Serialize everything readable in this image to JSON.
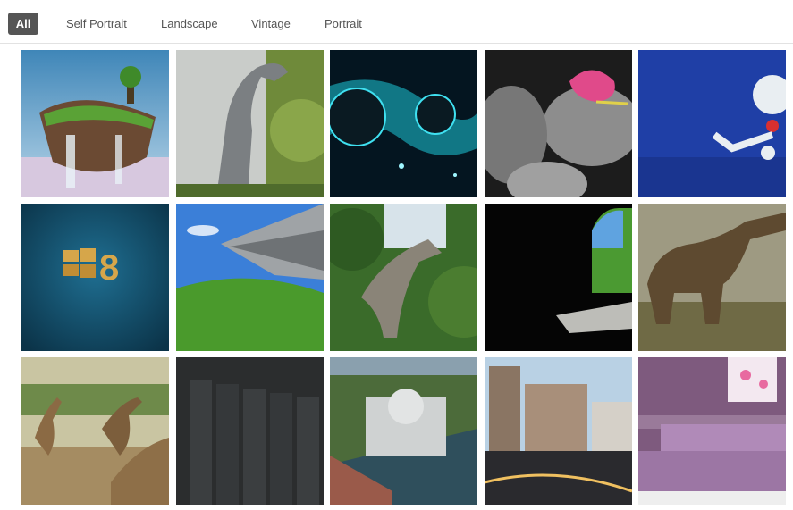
{
  "filters": {
    "all": "All",
    "self_portrait": "Self Portrait",
    "landscape": "Landscape",
    "vintage": "Vintage",
    "portrait": "Portrait",
    "active": "all"
  },
  "gallery": {
    "images": [
      {
        "subject": "floating-island"
      },
      {
        "subject": "trex-jungle"
      },
      {
        "subject": "space-planets"
      },
      {
        "subject": "stones-petal"
      },
      {
        "subject": "balloon-figure"
      },
      {
        "subject": "windows-8-logo"
      },
      {
        "subject": "star-destroyer-bliss"
      },
      {
        "subject": "dinosaur-trees"
      },
      {
        "subject": "dark-cave-bliss"
      },
      {
        "subject": "sauropod"
      },
      {
        "subject": "dinosaur-herd"
      },
      {
        "subject": "server-racks"
      },
      {
        "subject": "parliament-aerial"
      },
      {
        "subject": "city-night"
      },
      {
        "subject": "purple-bedroom"
      }
    ]
  },
  "colors": {
    "active_filter_bg": "#555555",
    "filter_text": "#555555",
    "divider": "#e2e2e2"
  }
}
